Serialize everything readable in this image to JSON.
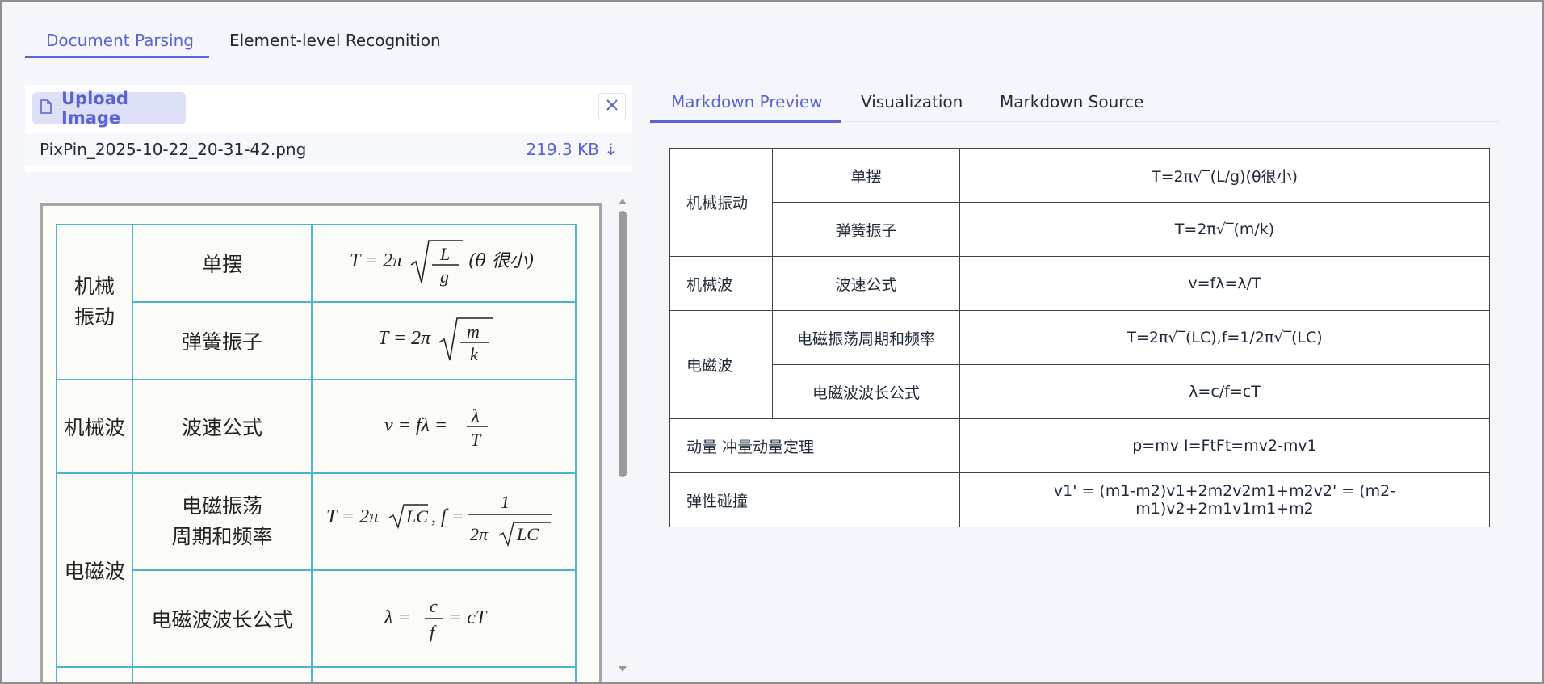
{
  "top_tabs": [
    {
      "label": "Document Parsing",
      "active": true
    },
    {
      "label": "Element-level Recognition",
      "active": false
    }
  ],
  "upload": {
    "button_label": "Upload Image",
    "file_name": "PixPin_2025-10-22_20-31-42.png",
    "file_size": "219.3 KB ⇣"
  },
  "scan": {
    "rows": [
      {
        "category": "机械\n振动",
        "item": "单摆"
      },
      {
        "item": "弹簧振子"
      },
      {
        "category": "机械波",
        "item": "波速公式"
      },
      {
        "category": "电磁波",
        "item": "电磁振荡\n周期和频率"
      },
      {
        "item": "电磁波波长公式"
      }
    ]
  },
  "right_tabs": [
    {
      "label": "Markdown Preview",
      "active": true
    },
    {
      "label": "Visualization",
      "active": false
    },
    {
      "label": "Markdown Source",
      "active": false
    }
  ],
  "md_table": {
    "rows": [
      {
        "category": "机械振动",
        "item": "单摆",
        "formula": "T=2π√‾(L/g)(θ很小)"
      },
      {
        "item": "弹簧振子",
        "formula": "T=2π√‾(m/k)"
      },
      {
        "category": "机械波",
        "item": "波速公式",
        "formula": "v=fλ=λ/T"
      },
      {
        "category": "电磁波",
        "item": "电磁振荡周期和频率",
        "formula": "T=2π√‾(LC),f=1/2π√‾(LC)"
      },
      {
        "item": "电磁波波长公式",
        "formula": "λ=c/f=cT"
      },
      {
        "merged": "动量 冲量动量定理",
        "formula": "p=mv I=FtFt=mv2-mv1"
      },
      {
        "merged": "弹性碰撞",
        "formula": "v1' = (m1-m2)v1+2m2v2m1+m2v2' = (m2-m1)v2+2m1v1m1+m2"
      }
    ]
  },
  "colors": {
    "accent": "#5b63d3",
    "scan_border": "#4fb3cf"
  }
}
